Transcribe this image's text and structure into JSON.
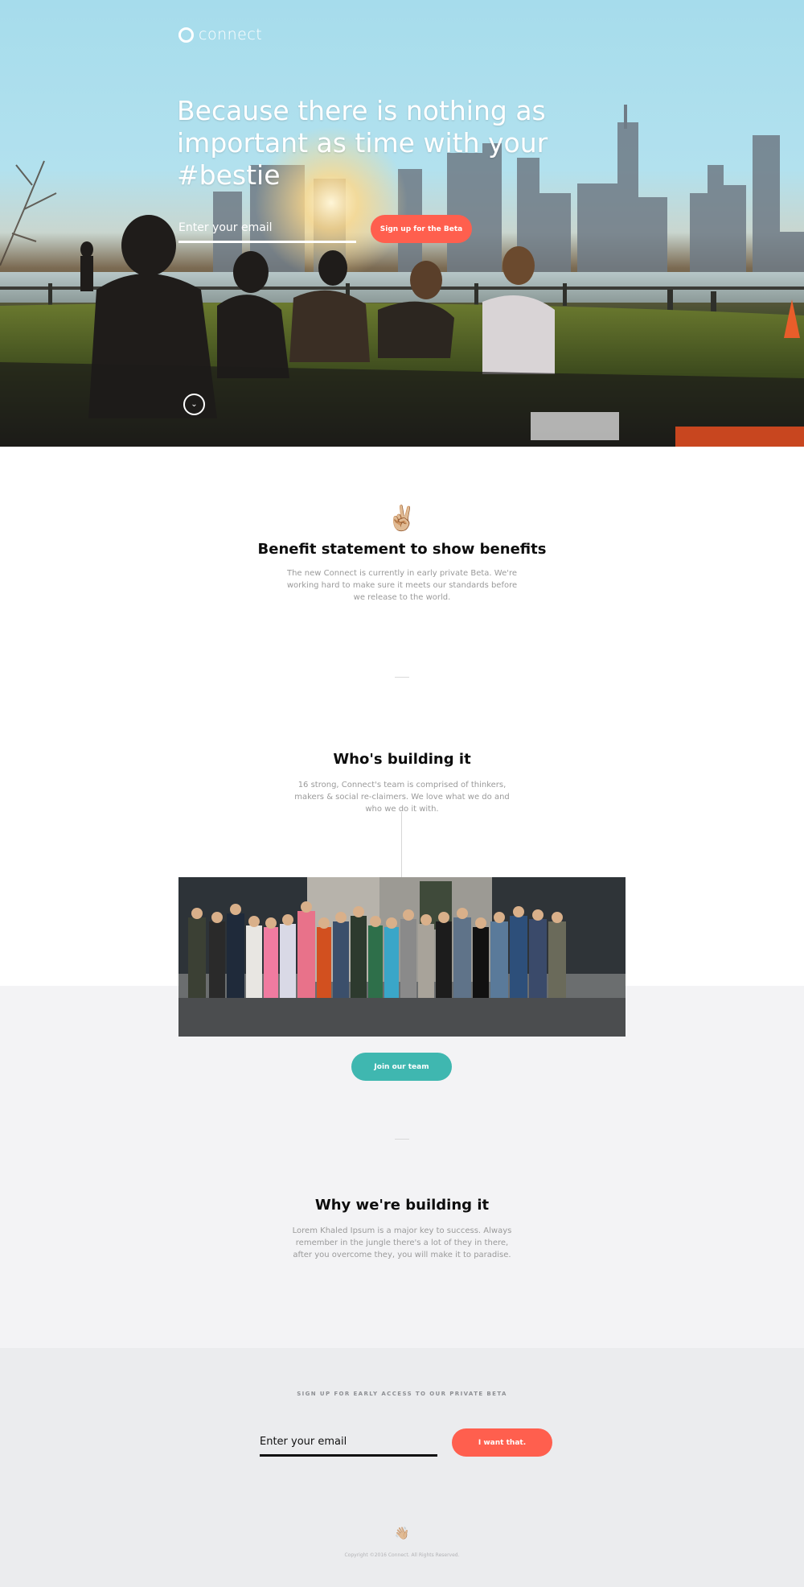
{
  "hero": {
    "logo_text": "connect",
    "headline": "Because there is nothing as important as time with your #bestie",
    "email_placeholder": "Enter your email",
    "cta_label": "Sign up for the Beta"
  },
  "benefit": {
    "emoji": "✌🏼",
    "title": "Benefit statement to show benefits",
    "text": "The new Connect is currently in early private Beta. We're working hard to make sure it meets our standards before we release to the world."
  },
  "team": {
    "title": "Who's building it",
    "text": "16 strong, Connect's team is comprised of thinkers, makers & social re-claimers. We love what we do and who we do it with.",
    "cta_label": "Join our team"
  },
  "why": {
    "title": "Why we're building it",
    "text": "Lorem Khaled Ipsum is a major key to success. Always remember in the jungle there's a lot of they in there, after you overcome they, you will make it to paradise."
  },
  "signup": {
    "kicker": "SIGN UP FOR EARLY ACCESS TO OUR PRIVATE BETA",
    "email_placeholder": "Enter your email",
    "cta_label": "I want that."
  },
  "footer": {
    "emoji": "👋🏼",
    "copyright": "Copyright ©2016 Connect. All Rights Reserved."
  },
  "colors": {
    "accent_red": "#ff5f4e",
    "accent_teal": "#3fb7b0",
    "grey_band": "#f3f3f5",
    "footer_band": "#ebecee"
  }
}
